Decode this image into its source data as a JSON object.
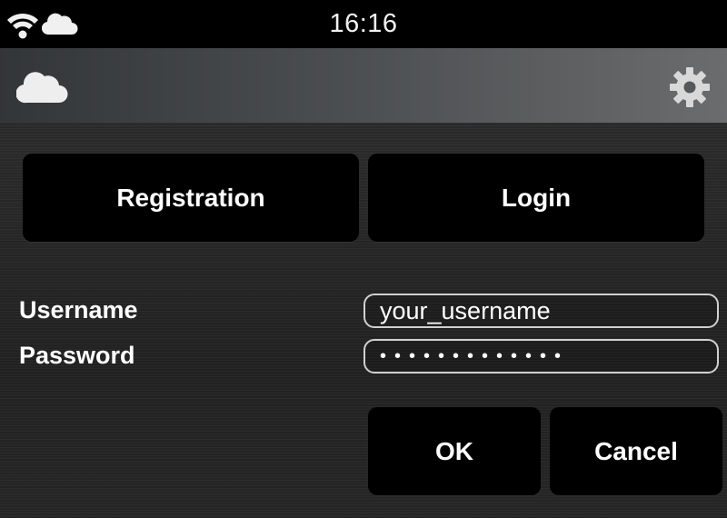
{
  "status_bar": {
    "time": "16:16",
    "icons": [
      "wifi-icon",
      "cloud-icon"
    ]
  },
  "header": {
    "logo_icon": "cloud-icon",
    "settings_icon": "gear-icon"
  },
  "tabs": {
    "registration_label": "Registration",
    "login_label": "Login"
  },
  "form": {
    "username_label": "Username",
    "username_value": "your_username",
    "password_label": "Password",
    "password_masked": "•••••••••••••"
  },
  "actions": {
    "ok_label": "OK",
    "cancel_label": "Cancel"
  },
  "colors": {
    "button_bg": "#000000",
    "text": "#ffffff",
    "field_border": "#d0d0d0"
  }
}
